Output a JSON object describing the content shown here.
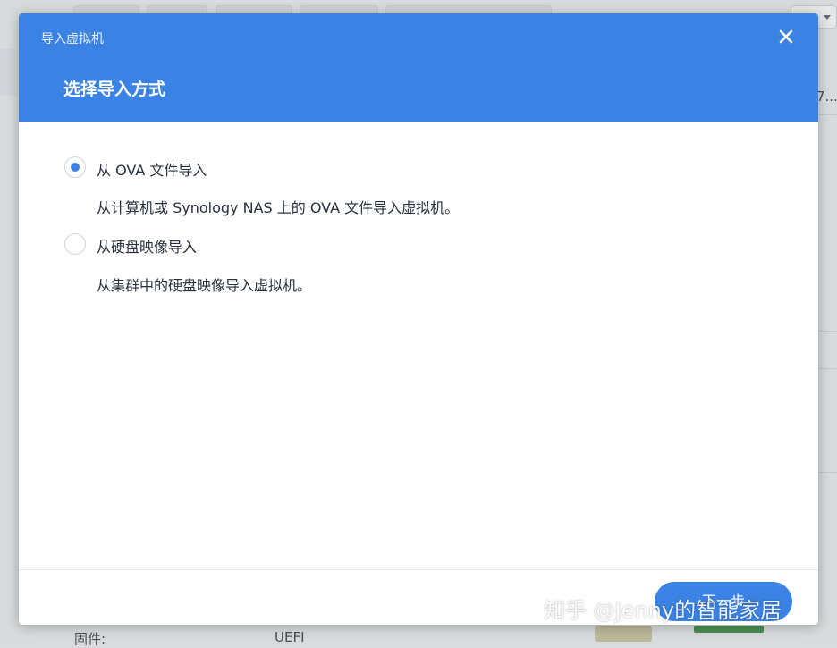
{
  "background": {
    "right_text": "7...",
    "firmware_label": "固件:",
    "firmware_value": "UEFI"
  },
  "dialog": {
    "title": "导入虚拟机",
    "step_title": "选择导入方式",
    "close_icon": "close-icon",
    "options": [
      {
        "label": "从 OVA 文件导入",
        "description": "从计算机或 Synology NAS 上的 OVA 文件导入虚拟机。",
        "selected": true
      },
      {
        "label": "从硬盘映像导入",
        "description": "从集群中的硬盘映像导入虚拟机。",
        "selected": false
      }
    ],
    "next_button": "下一步"
  },
  "watermark": "知乎 @Jenny的智能家居",
  "colors": {
    "header": "#3a82e3",
    "accent": "#3a82e3"
  }
}
